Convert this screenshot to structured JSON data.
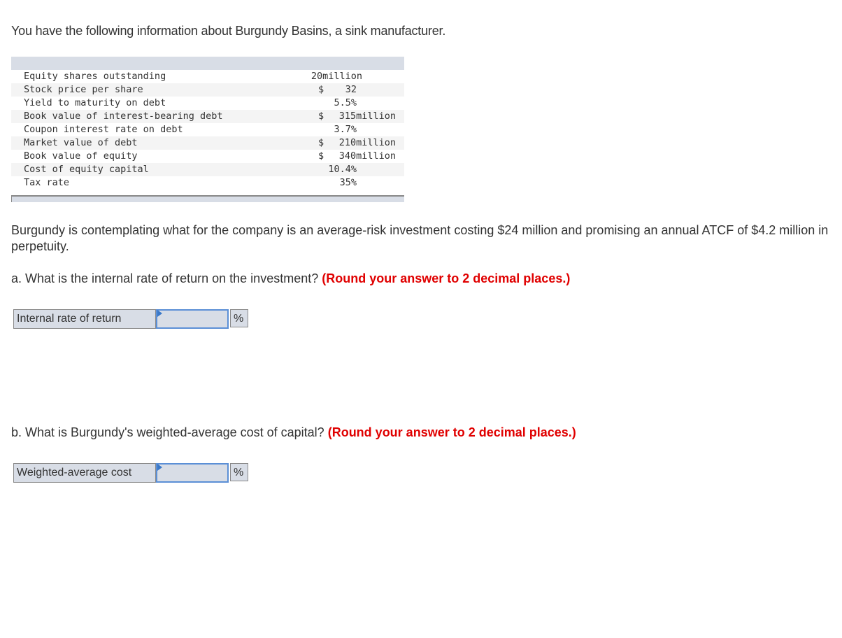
{
  "intro": "You have the following information about Burgundy Basins, a sink manufacturer.",
  "table": {
    "rows": [
      {
        "label": "Equity shares outstanding",
        "currency": "",
        "value": "20",
        "unit": "million"
      },
      {
        "label": "Stock price per share",
        "currency": "$",
        "value": "32",
        "unit": ""
      },
      {
        "label": "Yield to maturity on debt",
        "currency": "",
        "value": "5.5%",
        "unit": ""
      },
      {
        "label": "Book value of interest-bearing debt",
        "currency": "$",
        "value": "315",
        "unit": "million"
      },
      {
        "label": "Coupon interest rate on debt",
        "currency": "",
        "value": "3.7%",
        "unit": ""
      },
      {
        "label": "Market value of debt",
        "currency": "$",
        "value": "210",
        "unit": "million"
      },
      {
        "label": "Book value of equity",
        "currency": "$",
        "value": "340",
        "unit": "million"
      },
      {
        "label": "Cost of equity capital",
        "currency": "",
        "value": "10.4%",
        "unit": ""
      },
      {
        "label": "Tax rate",
        "currency": "",
        "value": "35%",
        "unit": ""
      }
    ]
  },
  "scenario": "Burgundy is contemplating what for the company is an average-risk investment costing $24 million and promising an annual ATCF of $4.2 million in perpetuity.",
  "question_a": {
    "text": "a. What is the internal rate of return on the investment?",
    "instruction": "(Round your answer to 2 decimal places.)",
    "field_label": "Internal rate of return",
    "value": "",
    "unit": "%"
  },
  "question_b": {
    "text": "b. What is Burgundy's weighted-average cost of capital?",
    "instruction": "(Round your answer to 2 decimal places.)",
    "field_label": "Weighted-average cost",
    "value": "",
    "unit": "%"
  }
}
